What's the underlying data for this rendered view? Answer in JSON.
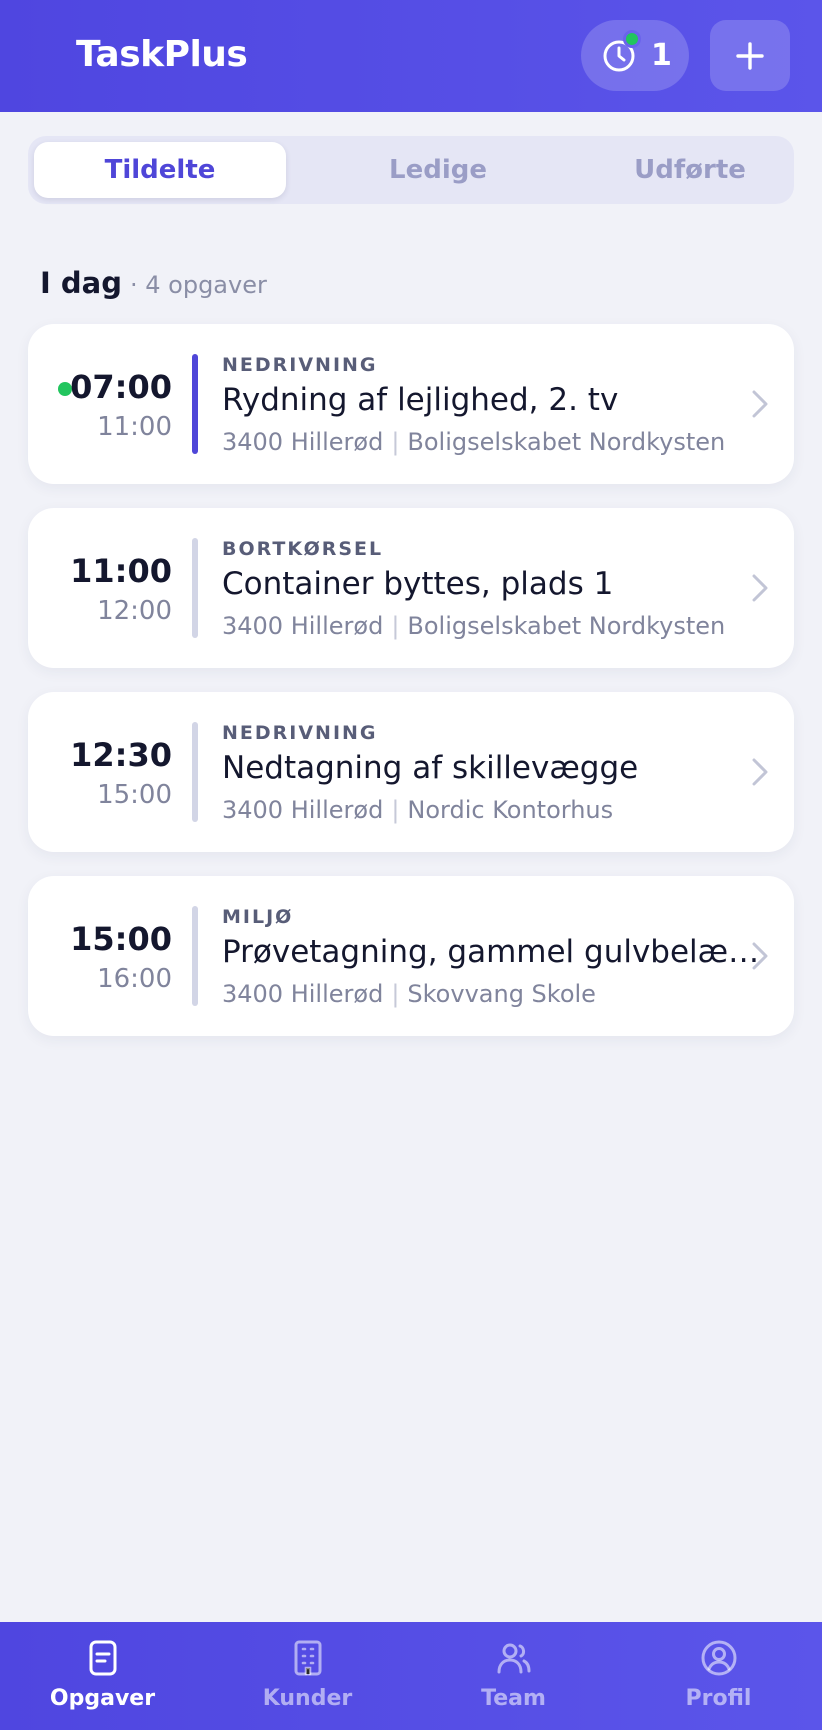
{
  "header": {
    "title": "TaskPlus",
    "timer_count": "1",
    "add_icon": "plus-icon",
    "timer_icon": "clock-icon"
  },
  "tabs": [
    {
      "label": "Tildelte",
      "active": true
    },
    {
      "label": "Ledige",
      "active": false
    },
    {
      "label": "Udførte",
      "active": false
    }
  ],
  "section": {
    "title": "I dag",
    "count": "· 4 opgaver"
  },
  "tasks": [
    {
      "start": "07:00",
      "end": "11:00",
      "category": "NEDRIVNING",
      "title": "Rydning af lejlighed, 2. tv",
      "location": "3400 Hillerød",
      "customer": "Boligselskabet Nordkysten",
      "active": true
    },
    {
      "start": "11:00",
      "end": "12:00",
      "category": "BORTKØRSEL",
      "title": "Container byttes, plads 1",
      "location": "3400 Hillerød",
      "customer": "Boligselskabet Nordkysten",
      "active": false
    },
    {
      "start": "12:30",
      "end": "15:00",
      "category": "NEDRIVNING",
      "title": "Nedtagning af skillevægge",
      "location": "3400 Hillerød",
      "customer": "Nordic Kontorhus",
      "active": false
    },
    {
      "start": "15:00",
      "end": "16:00",
      "category": "MILJØ",
      "title": "Prøvetagning, gammel gulvbelægning",
      "location": "3400 Hillerød",
      "customer": "Skovvang Skole",
      "active": false
    }
  ],
  "nav": [
    {
      "label": "Opgaver",
      "icon": "clipboard-icon",
      "active": true
    },
    {
      "label": "Kunder",
      "icon": "building-icon",
      "active": false
    },
    {
      "label": "Team",
      "icon": "users-icon",
      "active": false
    },
    {
      "label": "Profil",
      "icon": "user-circle-icon",
      "active": false
    }
  ],
  "colors": {
    "brand": "#4f46e0",
    "accent": "#4f46d8",
    "success": "#22c55e",
    "background": "#f1f2f8"
  }
}
